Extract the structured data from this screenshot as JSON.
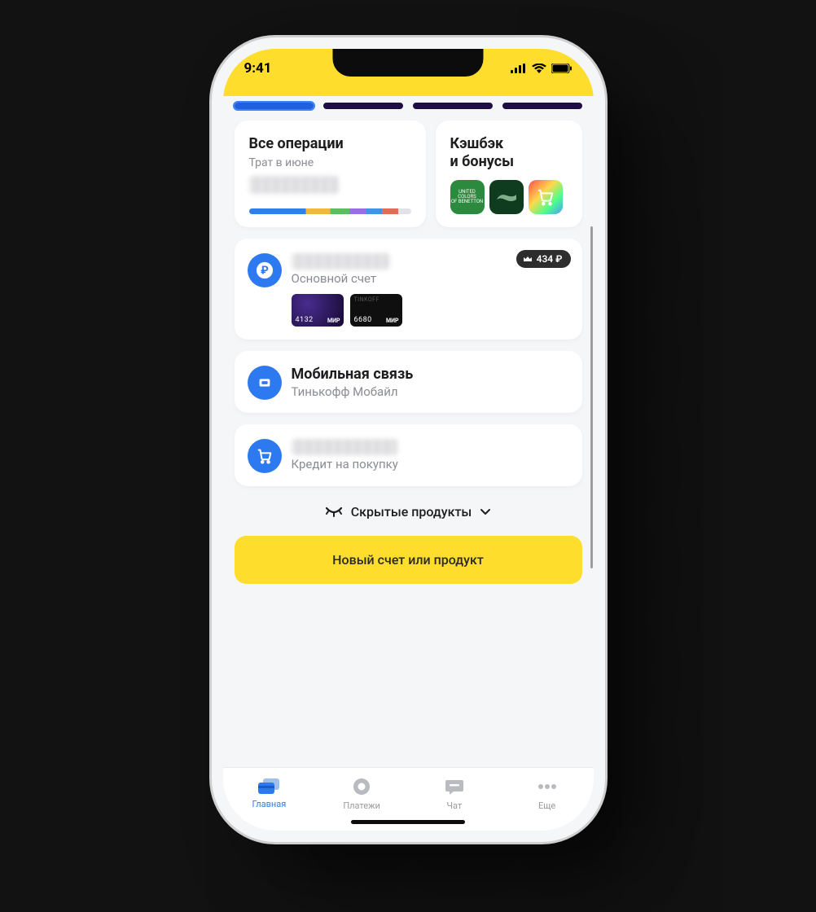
{
  "status": {
    "time": "9:41"
  },
  "ops_card": {
    "title": "Все операции",
    "subtitle": "Трат в июне"
  },
  "cash_card": {
    "title_l1": "Кэшбэк",
    "title_l2": "и бонусы"
  },
  "accounts": {
    "main": {
      "subtitle": "Основной счет",
      "badge_amount": "434 ₽",
      "card_a": {
        "num": "4132",
        "sys": "МИР"
      },
      "card_b": {
        "num": "6680",
        "sys": "МИР"
      }
    },
    "mobile": {
      "title": "Мобильная связь",
      "subtitle": "Тинькофф Мобайл"
    },
    "credit": {
      "subtitle": "Кредит на покупку"
    }
  },
  "hidden_label": "Скрытые продукты",
  "cta_label": "Новый счет или продукт",
  "tabs": {
    "home": "Главная",
    "payments": "Платежи",
    "chat": "Чат",
    "more": "Еще"
  }
}
